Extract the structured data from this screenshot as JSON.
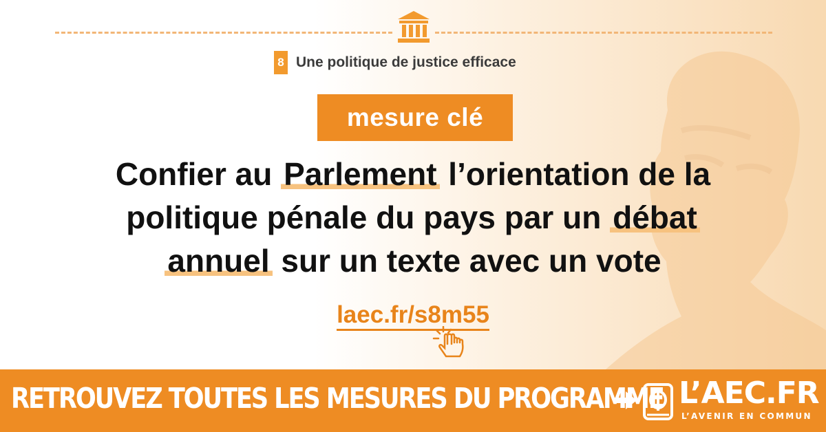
{
  "header": {
    "section_number": "8",
    "section_title": "Une politique de justice efficace"
  },
  "badge": {
    "label": "mesure clé"
  },
  "headline": {
    "line1_a": "Confier au ",
    "line1_hl": "Parlement",
    "line1_b": " l’orientation de la",
    "line2_a": "politique pénale du pays par un ",
    "line2_hl": "débat",
    "line3_hl": "annuel",
    "line3_b": " sur un texte avec un vote"
  },
  "link": {
    "text": "laec.fr/s8m55"
  },
  "footer": {
    "cta": "RETROUVEZ TOUTES LES MESURES DU PROGRAMME",
    "logo_text": "L’AEC.FR",
    "logo_subtitle": "L’AVENIR EN COMMUN"
  },
  "colors": {
    "accent": "#ee8c23",
    "highlight": "#f7c27f",
    "text": "#111111",
    "link": "#e8841a"
  },
  "icons": {
    "building": "building-columns-icon",
    "hand": "pointing-hand-icon",
    "arrow": "arrow-right-icon",
    "logo": "phi-book-logo-icon"
  }
}
